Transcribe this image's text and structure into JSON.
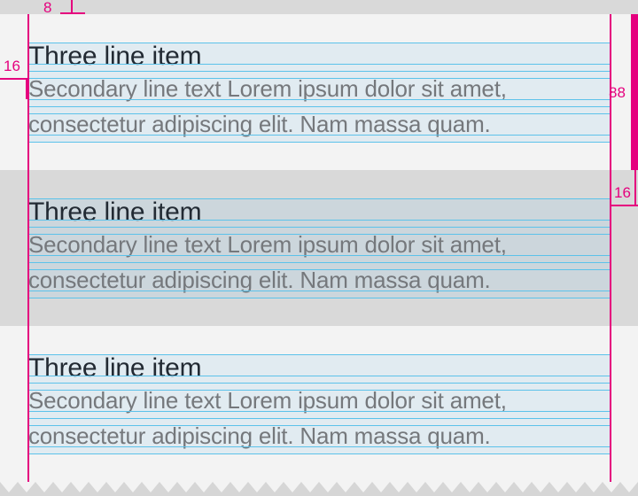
{
  "list_items": [
    {
      "state": "default",
      "primary": "Three line item",
      "secondary_line_1": "Secondary line text Lorem ipsum dolor sit amet,",
      "secondary_line_2": "consectetur adipiscing elit. Nam massa quam."
    },
    {
      "state": "pressed",
      "primary": "Three line item",
      "secondary_line_1": "Secondary line text Lorem ipsum dolor sit amet,",
      "secondary_line_2": "consectetur adipiscing elit. Nam massa quam."
    },
    {
      "state": "default",
      "primary": "Three line item",
      "secondary_line_1": "Secondary line text Lorem ipsum dolor sit amet,",
      "secondary_line_2": "consectetur adipiscing elit. Nam massa quam."
    }
  ],
  "annotations": {
    "top_spacing": "8",
    "left_padding": "16",
    "item_height": "88",
    "right_padding": "16"
  },
  "colors": {
    "background": "#f3f3f3",
    "pressed_row": "#d9d9d9",
    "redline": "#e5007e",
    "baseline_grid": "#5cc2ea",
    "primary_text": "#222a33",
    "secondary_text": "#75787c"
  }
}
